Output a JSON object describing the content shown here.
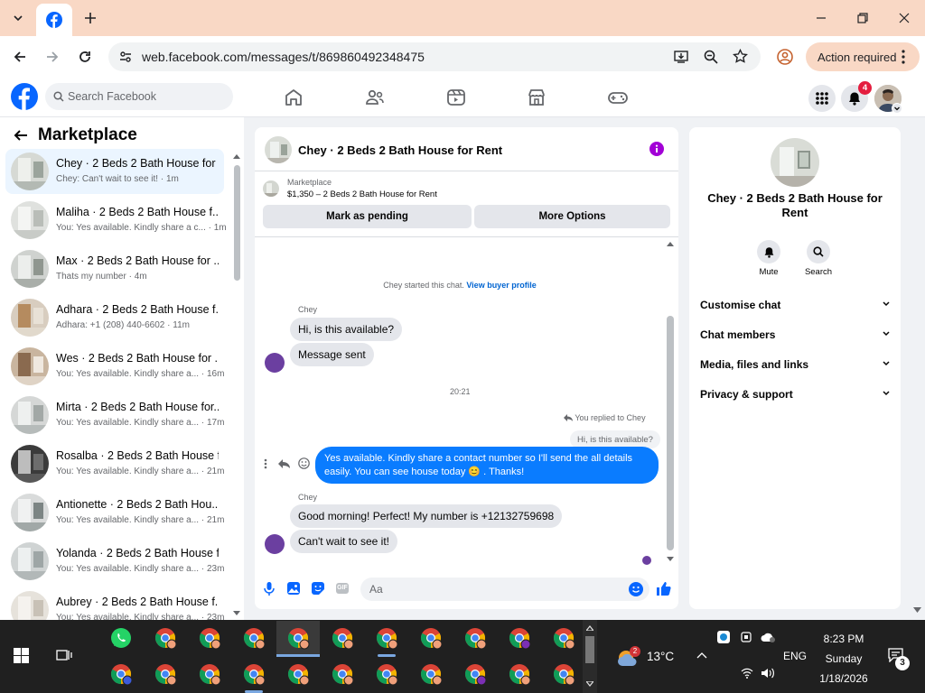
{
  "browser": {
    "url": "web.facebook.com/messages/t/869860492348475",
    "action_required": "Action required"
  },
  "fb_header": {
    "search_placeholder": "Search Facebook",
    "notification_count": "4"
  },
  "sidebar": {
    "title": "Marketplace",
    "conversations": [
      {
        "name": "Chey · 2 Beds 2 Bath House for ...",
        "preview": "Chey: Can't wait to see it! · 1m"
      },
      {
        "name": "Maliha · 2 Beds 2 Bath House f...",
        "preview": "You: Yes available. Kindly share a c... · 1m"
      },
      {
        "name": "Max · 2 Beds 2 Bath House for ...",
        "preview": "Thats my number · 4m"
      },
      {
        "name": "Adhara · 2 Beds 2 Bath House f...",
        "preview": "Adhara: +1 (208) 440-6602 · 11m"
      },
      {
        "name": "Wes · 2 Beds 2 Bath House for ...",
        "preview": "You: Yes available. Kindly share a... · 16m"
      },
      {
        "name": "Mirta · 2 Beds 2 Bath House for...",
        "preview": "You: Yes available. Kindly share a... · 17m"
      },
      {
        "name": "Rosalba · 2 Beds 2 Bath House f...",
        "preview": "You: Yes available. Kindly share a... · 21m"
      },
      {
        "name": "Antionette · 2 Beds 2 Bath Hou...",
        "preview": "You: Yes available. Kindly share a... · 21m"
      },
      {
        "name": "Yolanda · 2 Beds 2 Bath House f...",
        "preview": "You: Yes available. Kindly share a... · 23m"
      },
      {
        "name": "Aubrey · 2 Beds 2 Bath House f...",
        "preview": "You: Yes available. Kindly share a... · 23m"
      }
    ]
  },
  "chat": {
    "title": "Chey · 2 Beds 2 Bath House for Rent",
    "listing_source": "Marketplace",
    "listing_detail": "$1,350 – 2 Beds 2 Bath House for Rent",
    "mark_pending": "Mark as pending",
    "more_options": "More Options",
    "started_text": "Chey started this chat.",
    "view_profile": "View buyer profile",
    "sender": "Chey",
    "msg1": "Hi, is this available?",
    "msg2": "Message sent",
    "time": "20:21",
    "replied_to": "You replied to Chey",
    "quoted": "Hi, is this available?",
    "my_msg": "Yes available. Kindly share a contact number so I'll send the all details easily. You can see house today 😊 . Thanks!",
    "sender2": "Chey",
    "msg3": "Good morning! Perfect! My number is +12132759698",
    "msg4": "Can't wait to see it!",
    "input_placeholder": "Aa"
  },
  "info": {
    "title": "Chey · 2 Beds 2 Bath House for Rent",
    "mute": "Mute",
    "search": "Search",
    "sections": [
      "Customise chat",
      "Chat members",
      "Media, files and links",
      "Privacy & support"
    ]
  },
  "taskbar": {
    "temperature": "13°C",
    "weather_badge": "2",
    "language": "ENG",
    "time": "8:23 PM",
    "day": "Sunday",
    "date": "1/18/2026",
    "notif_count": "3"
  },
  "colors": {
    "fb_blue": "#0866ff",
    "bubble_blue": "#0a7cff",
    "tab_strip": "#f9d8c5",
    "taskbar": "#202020"
  }
}
